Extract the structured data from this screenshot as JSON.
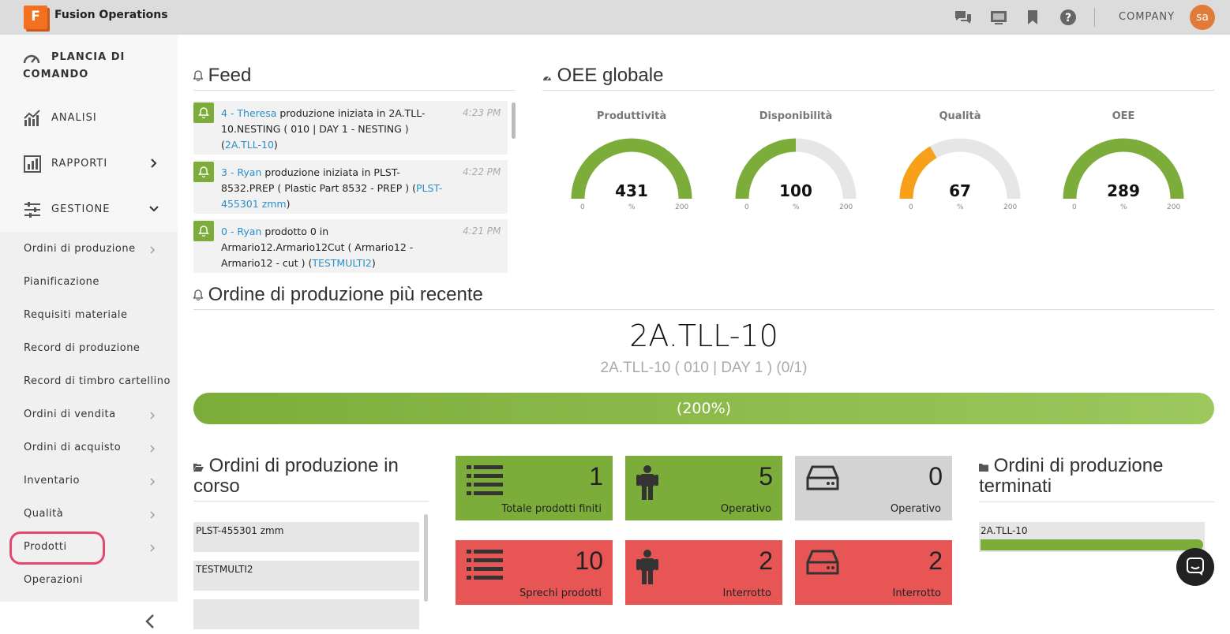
{
  "header": {
    "logo_letter": "F",
    "app_title": "Fusion Operations",
    "company": "COMPANY",
    "avatar": "sa",
    "icons": [
      "chat-icon",
      "display-icon",
      "bookmark-icon",
      "help-icon"
    ]
  },
  "sidebar": {
    "dashboard": "PLANCIA DI COMANDO",
    "main": [
      {
        "label": "ANALISI"
      },
      {
        "label": "RAPPORTI"
      },
      {
        "label": "GESTIONE"
      }
    ],
    "sub": [
      {
        "label": "Ordini di produzione",
        "chevron": true
      },
      {
        "label": "Pianificazione",
        "chevron": false
      },
      {
        "label": "Requisiti materiale",
        "chevron": false
      },
      {
        "label": "Record di produzione",
        "chevron": false
      },
      {
        "label": "Record di timbro cartellino",
        "chevron": false
      },
      {
        "label": "Ordini di vendita",
        "chevron": true
      },
      {
        "label": "Ordini di acquisto",
        "chevron": true
      },
      {
        "label": "Inventario",
        "chevron": true
      },
      {
        "label": "Qualità",
        "chevron": true
      },
      {
        "label": "Prodotti",
        "chevron": true
      },
      {
        "label": "Operazioni",
        "chevron": false
      }
    ]
  },
  "feed": {
    "title": "Feed",
    "items": [
      {
        "who": "4 - Theresa",
        "pre": " produzione iniziata in 2A.TLL-10.NESTING ( 010 | DAY 1 - NESTING ) (",
        "link": "2A.TLL-10",
        "post": ")",
        "time": "4:23 PM"
      },
      {
        "who": "3 - Ryan",
        "pre": " produzione iniziata in PLST-8532.PREP ( Plastic Part 8532 - PREP ) (",
        "link": "PLST-455301 zmm",
        "post": ")",
        "time": "4:22 PM"
      },
      {
        "who": "0 - Ryan",
        "pre": " prodotto 0 in Armario12.Armario12Cut ( Armario12 - Armario12 - cut ) (",
        "link": "TESTMULTI2",
        "post": ")",
        "time": "4:21 PM"
      }
    ]
  },
  "oee": {
    "title": "OEE globale",
    "gauges": [
      {
        "label": "Produttività",
        "value": "431",
        "min": "0",
        "max": "200",
        "unit": "%",
        "fraction": 1,
        "color": "#7cad3a"
      },
      {
        "label": "Disponibilità",
        "value": "100",
        "min": "0",
        "max": "200",
        "unit": "%",
        "fraction": 0.5,
        "color": "#7cad3a"
      },
      {
        "label": "Qualità",
        "value": "67",
        "min": "0",
        "max": "200",
        "unit": "%",
        "fraction": 0.335,
        "color": "#f7a11a"
      },
      {
        "label": "OEE",
        "value": "289",
        "min": "0",
        "max": "200",
        "unit": "%",
        "fraction": 1,
        "color": "#7cad3a"
      }
    ]
  },
  "recent": {
    "title": "Ordine di produzione più recente",
    "order": "2A.TLL-10",
    "sub": "2A.TLL-10 ( 010 | DAY 1 ) (0/1)",
    "progress": "(200%)",
    "progress_value": 2.0
  },
  "in_progress": {
    "title": "Ordini di produzione in corso",
    "items": [
      "PLST-455301 zmm",
      "TESTMULTI2"
    ]
  },
  "tiles": [
    {
      "num": "1",
      "label": "Totale prodotti finiti",
      "color": "green",
      "icon": "list-icon"
    },
    {
      "num": "5",
      "label": "Operativo",
      "color": "green",
      "icon": "person-icon"
    },
    {
      "num": "0",
      "label": "Operativo",
      "color": "grey",
      "icon": "machine-icon"
    },
    {
      "num": "10",
      "label": "Sprechi prodotti",
      "color": "red",
      "icon": "list-icon"
    },
    {
      "num": "2",
      "label": "Interrotto",
      "color": "red",
      "icon": "person-icon"
    },
    {
      "num": "2",
      "label": "Interrotto",
      "color": "red",
      "icon": "machine-icon"
    }
  ],
  "finished": {
    "title": "Ordini di produzione terminati",
    "items": [
      {
        "label": "2A.TLL-10",
        "progress": 1
      }
    ]
  }
}
